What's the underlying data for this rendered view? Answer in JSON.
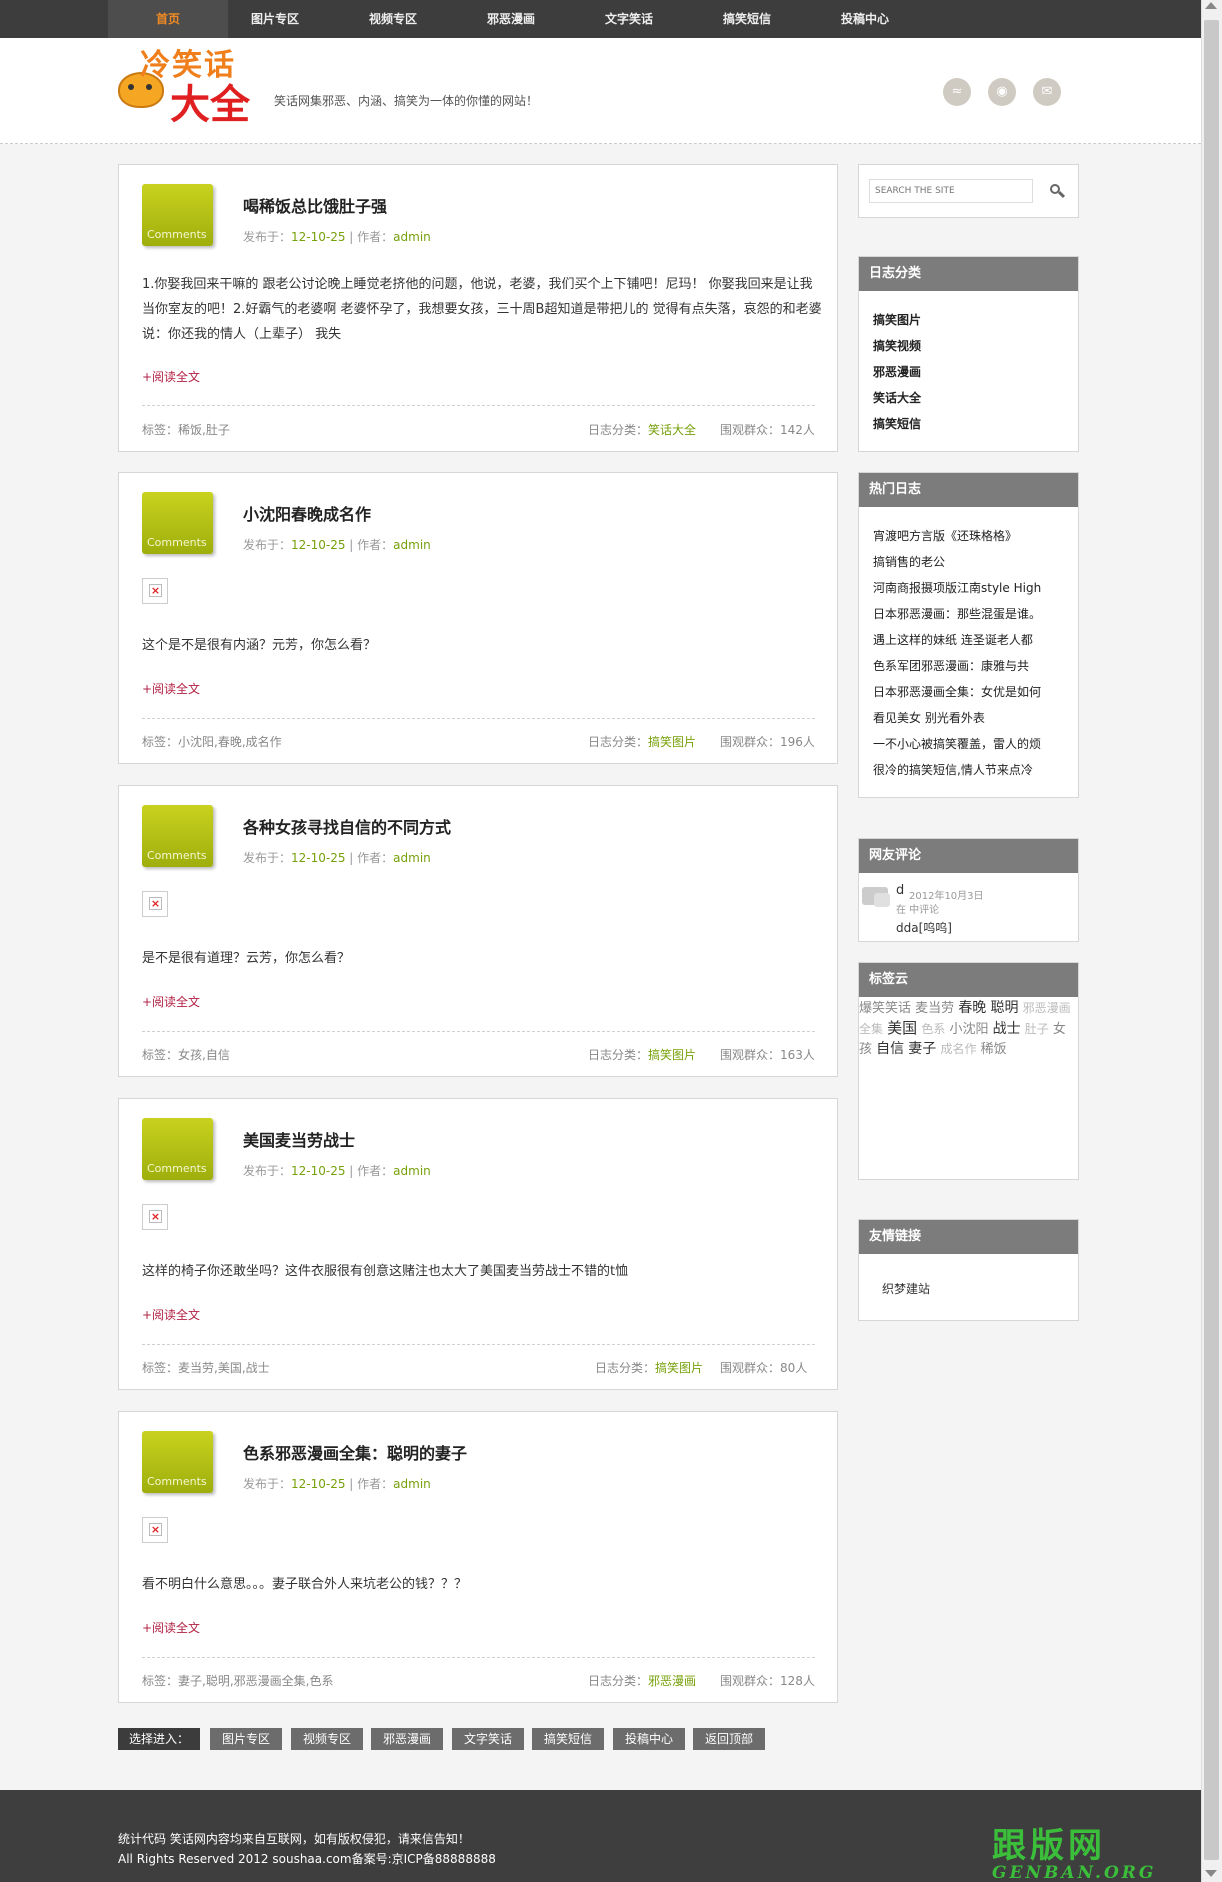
{
  "nav": {
    "items": [
      "首页",
      "图片专区",
      "视频专区",
      "邪恶漫画",
      "文字笑话",
      "搞笑短信",
      "投稿中心"
    ]
  },
  "header": {
    "logo_line1": "冷笑话",
    "logo_line2": "大全",
    "slogan": "笑话网集邪恶、内涵、搞笑为一体的你懂的网站！",
    "social_icons": [
      "rss-icon",
      "weibo-icon",
      "mail-icon"
    ]
  },
  "posts": [
    {
      "comments_label": "Comments",
      "title": "喝稀饭总比饿肚子强",
      "meta_pre": "发布于：",
      "date": "12-10-25",
      "meta_mid": " | 作者：",
      "author": "admin",
      "excerpt": "1.你娶我回来干嘛的 跟老公讨论晚上睡觉老挤他的问题，他说，老婆，我们买个上下铺吧！尼玛！ 你娶我回来是让我当你室友的吧！2.好霸气的老婆啊 老婆怀孕了，我想要女孩，三十周B超知道是带把儿的 觉得有点失落，哀怨的和老婆说：你还我的情人（上辈子） 我失",
      "read_more": "+阅读全文",
      "tags": "标签：稀饭,肚子",
      "cat_label": "日志分类：",
      "category": "笑话大全",
      "views": "围观群众：142人"
    },
    {
      "comments_label": "Comments",
      "title": "小沈阳春晚成名作",
      "meta_pre": "发布于：",
      "date": "12-10-25",
      "meta_mid": " | 作者：",
      "author": "admin",
      "excerpt": "这个是不是很有内涵？元芳，你怎么看？",
      "read_more": "+阅读全文",
      "tags": "标签：小沈阳,春晚,成名作",
      "cat_label": "日志分类：",
      "category": "搞笑图片",
      "views": "围观群众：196人"
    },
    {
      "comments_label": "Comments",
      "title": "各种女孩寻找自信的不同方式",
      "meta_pre": "发布于：",
      "date": "12-10-25",
      "meta_mid": " | 作者：",
      "author": "admin",
      "excerpt": "是不是很有道理？云芳，你怎么看？",
      "read_more": "+阅读全文",
      "tags": "标签：女孩,自信",
      "cat_label": "日志分类：",
      "category": "搞笑图片",
      "views": "围观群众：163人"
    },
    {
      "comments_label": "Comments",
      "title": "美国麦当劳战士",
      "meta_pre": "发布于：",
      "date": "12-10-25",
      "meta_mid": " | 作者：",
      "author": "admin",
      "excerpt": "这样的椅子你还敢坐吗？这件衣服很有创意这赌注也太大了美国麦当劳战士不错的t恤",
      "read_more": "+阅读全文",
      "tags": "标签：麦当劳,美国,战士",
      "cat_label": "日志分类：",
      "category": "搞笑图片",
      "views": "围观群众：80人"
    },
    {
      "comments_label": "Comments",
      "title": "色系邪恶漫画全集：聪明的妻子",
      "meta_pre": "发布于：",
      "date": "12-10-25",
      "meta_mid": " | 作者：",
      "author": "admin",
      "excerpt": "看不明白什么意思。。。妻子联合外人来坑老公的钱？？？",
      "read_more": "+阅读全文",
      "tags": "标签：妻子,聪明,邪恶漫画全集,色系",
      "cat_label": "日志分类：",
      "category": "邪恶漫画",
      "views": "围观群众：128人"
    }
  ],
  "sidebar": {
    "search_placeholder": "SEARCH THE SITE",
    "categories_title": "日志分类",
    "categories": [
      "搞笑图片",
      "搞笑视频",
      "邪恶漫画",
      "笑话大全",
      "搞笑短信"
    ],
    "hot_title": "热门日志",
    "hot": [
      "宵渡吧方言版《还珠格格》",
      "搞销售的老公",
      "河南商报摄项版江南style High",
      "日本邪恶漫画：那些混蛋是谁。",
      "遇上这样的妹纸 连圣诞老人都",
      "色系军团邪恶漫画：康雅与共",
      "日本邪恶漫画全集：女优是如何",
      "看见美女 别光看外表",
      "一不小心被搞笑覆盖，雷人的烦",
      "很冷的搞笑短信,情人节来点冷"
    ],
    "comments_title": "网友评论",
    "comment_user": "d",
    "comment_date": "2012年10月3日",
    "comment_where": "在 中评论",
    "comment_text": "dda[呜呜]",
    "tagcloud_title": "标签云",
    "tagcloud": [
      "爆笑笑话",
      "麦当劳",
      "春晚",
      "聪明",
      "邪恶漫画全集",
      "美国",
      "色系",
      "小沈阳",
      "战士",
      "肚子",
      "女孩",
      "自信",
      "妻子",
      "成名作",
      "稀饭"
    ],
    "links_title": "友情链接",
    "links": [
      "织梦建站"
    ]
  },
  "bottom_nav": {
    "label": "选择进入：",
    "items": [
      "图片专区",
      "视频专区",
      "邪恶漫画",
      "文字笑话",
      "搞笑短信",
      "投稿中心",
      "返回顶部"
    ]
  },
  "footer": {
    "line1": "统计代码 笑话网内容均来自互联网，如有版权侵犯，请来信告知！",
    "line2": "All Rights Reserved 2012 soushaa.com备案号:京ICP备88888888"
  },
  "watermark": {
    "line1": "跟版网",
    "line2": "GENBAN.ORG"
  },
  "colors": {
    "nav_bg": "#3d3d3d",
    "nav_active": "#f08a24",
    "accent_green": "#77a10b",
    "readmore": "#b22244",
    "widget_head": "#7c7c7c"
  }
}
